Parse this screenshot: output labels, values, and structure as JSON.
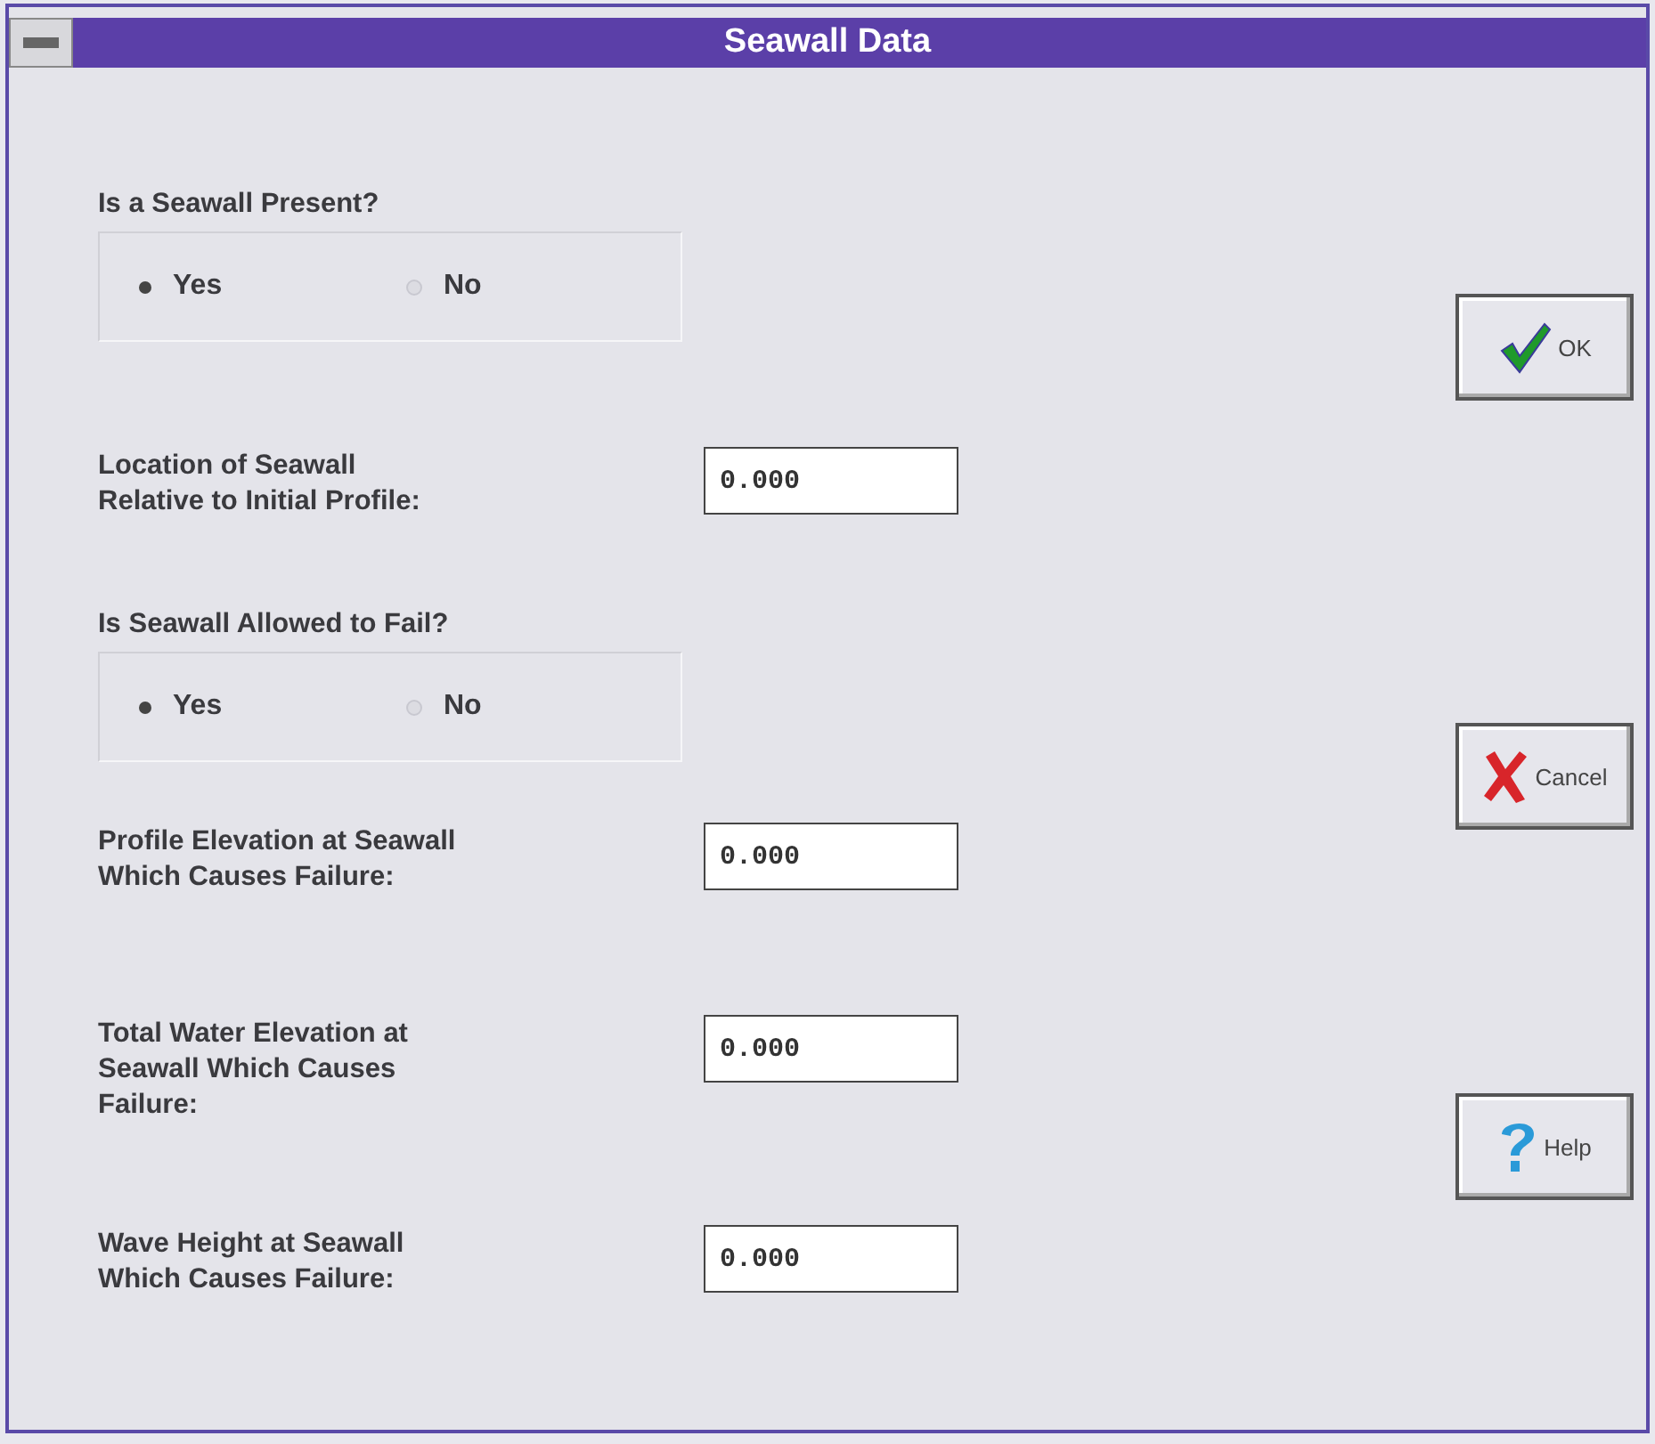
{
  "window": {
    "title": "Seawall Data"
  },
  "sections": [
    {
      "kind": "radio",
      "label": "Is a Seawall Present?",
      "options": [
        {
          "label": "Yes",
          "selected": true
        },
        {
          "label": "No",
          "selected": false
        }
      ]
    },
    {
      "kind": "field",
      "label_lines": [
        "Location of Seawall",
        "Relative to Initial Profile:"
      ],
      "value": "0.000"
    },
    {
      "kind": "radio",
      "label": "Is Seawall Allowed to Fail?",
      "options": [
        {
          "label": "Yes",
          "selected": true
        },
        {
          "label": "No",
          "selected": false
        }
      ]
    },
    {
      "kind": "field",
      "label_lines": [
        "Profile Elevation at Seawall",
        "Which Causes Failure:"
      ],
      "value": "0.000"
    },
    {
      "kind": "field",
      "label_lines": [
        "Total Water Elevation at",
        "Seawall Which Causes",
        "Failure:"
      ],
      "value": "0.000"
    },
    {
      "kind": "field",
      "label_lines": [
        "Wave Height at Seawall",
        "Which Causes Failure:"
      ],
      "value": "0.000"
    }
  ],
  "buttons": [
    {
      "kind": "ok",
      "label": "OK"
    },
    {
      "kind": "cancel",
      "label": "Cancel"
    },
    {
      "kind": "help",
      "label": "Help"
    }
  ]
}
